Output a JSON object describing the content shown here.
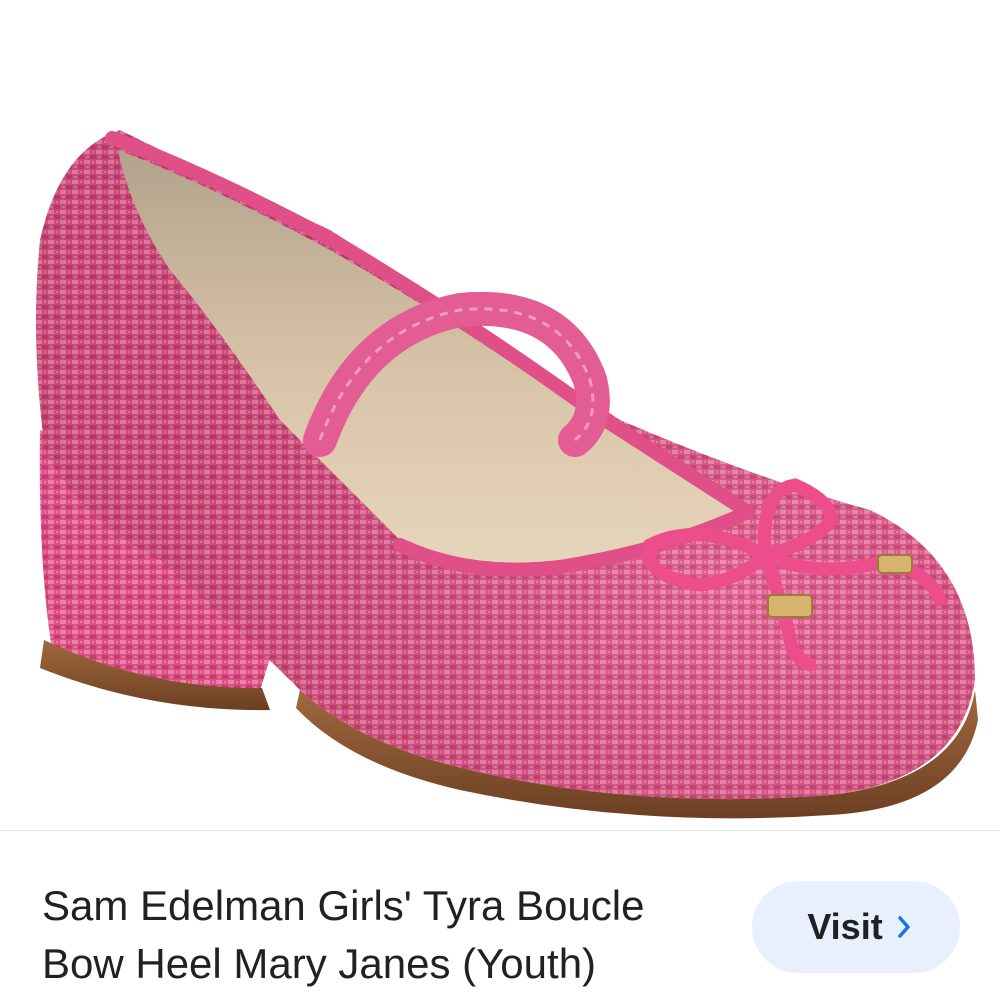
{
  "product": {
    "title": "Sam Edelman Girls' Tyra Boucle Bow Heel Mary Janes (Youth)",
    "image_alt": "Pink boucle Mary Jane shoe with bow and block heel"
  },
  "actions": {
    "visit_label": "Visit",
    "visit_icon": "chevron-right-icon"
  },
  "colors": {
    "shoe_pink": "#e0508a",
    "accent_blue": "#1a73e8",
    "button_bg": "#e8f0fe"
  }
}
